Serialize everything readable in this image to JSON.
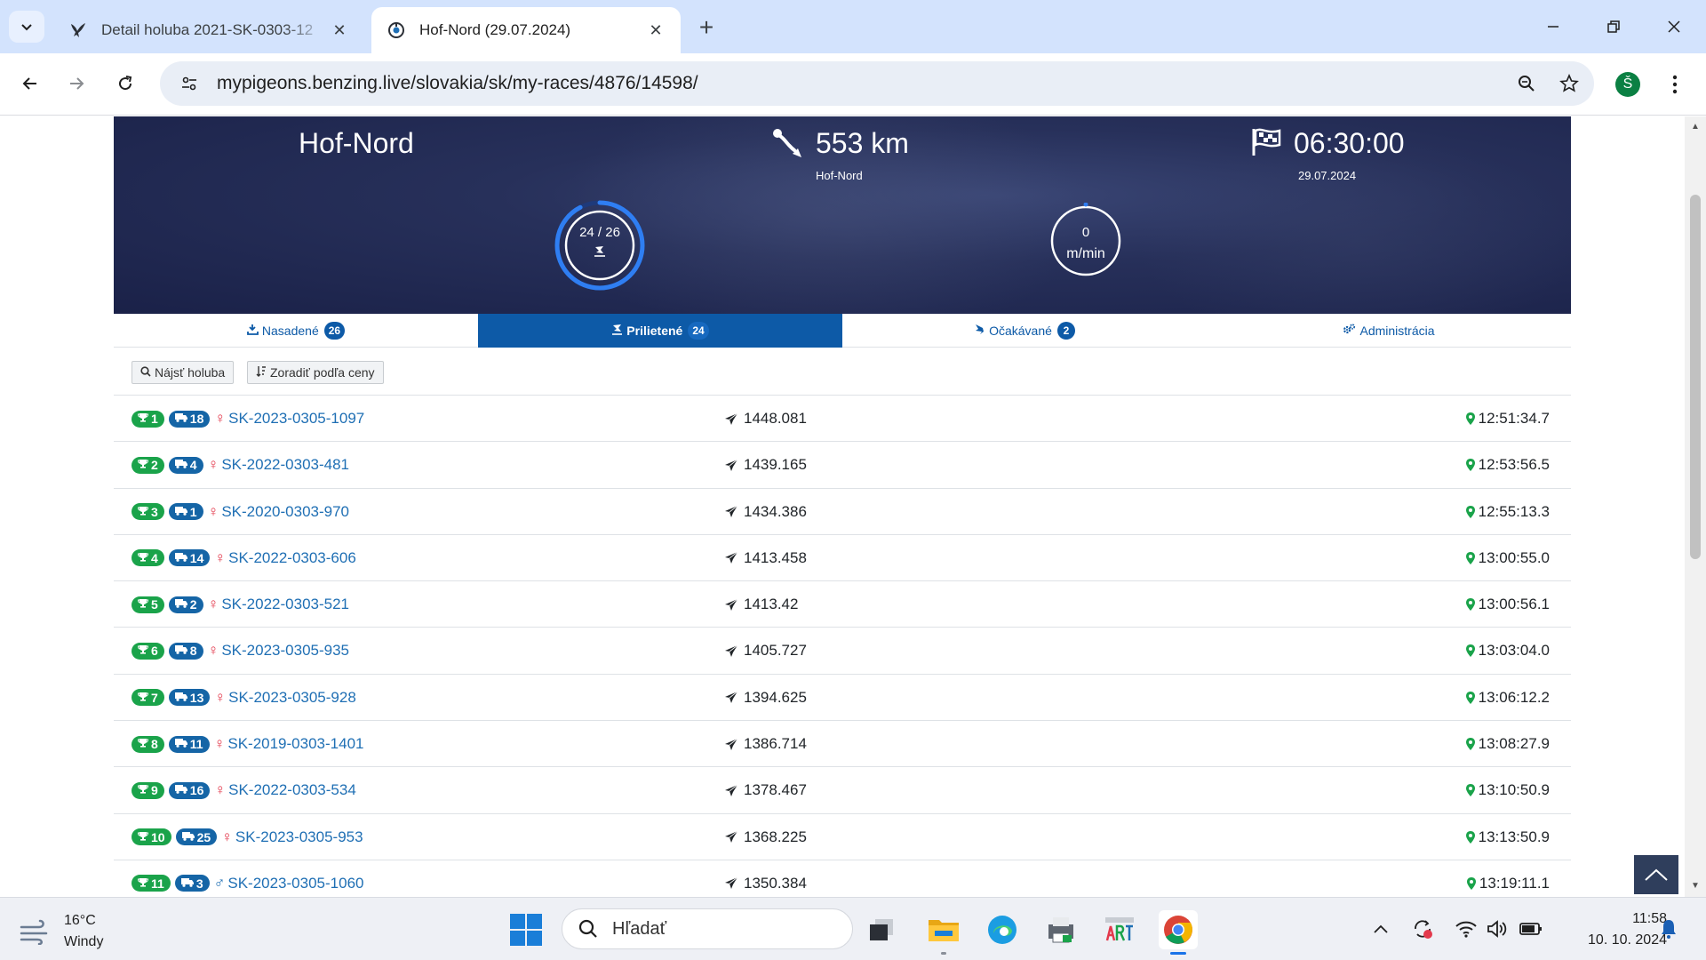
{
  "browser": {
    "tabs": [
      {
        "title": "Detail holuba 2021-SK-0303-12",
        "active": false
      },
      {
        "title": "Hof-Nord (29.07.2024)",
        "active": true
      }
    ],
    "url": "mypigeons.benzing.live/slovakia/sk/my-races/4876/14598/",
    "profile_initial": "Š"
  },
  "race": {
    "name": "Hof-Nord",
    "distance": "553 km",
    "release_point": "Hof-Nord",
    "start_time": "06:30:00",
    "date": "29.07.2024",
    "arrived_counter": "24 / 26",
    "arrived_fraction": 0.923,
    "speed_value": "0",
    "speed_unit": "m/min"
  },
  "page_tabs": [
    {
      "label": "Nasadené",
      "count": "26",
      "active": false
    },
    {
      "label": "Prilietené",
      "count": "24",
      "active": true
    },
    {
      "label": "Očakávané",
      "count": "2",
      "active": false
    },
    {
      "label": "Administrácia",
      "count": "",
      "active": false
    }
  ],
  "tools": {
    "find_label": "Nájsť holuba",
    "sort_label": "Zoradiť podľa ceny"
  },
  "results": [
    {
      "place": "1",
      "basket": "18",
      "sex": "female",
      "ring": "SK-2023-0305-1097",
      "speed": "1448.081",
      "arrival": "12:51:34.7"
    },
    {
      "place": "2",
      "basket": "4",
      "sex": "female",
      "ring": "SK-2022-0303-481",
      "speed": "1439.165",
      "arrival": "12:53:56.5"
    },
    {
      "place": "3",
      "basket": "1",
      "sex": "female",
      "ring": "SK-2020-0303-970",
      "speed": "1434.386",
      "arrival": "12:55:13.3"
    },
    {
      "place": "4",
      "basket": "14",
      "sex": "female",
      "ring": "SK-2022-0303-606",
      "speed": "1413.458",
      "arrival": "13:00:55.0"
    },
    {
      "place": "5",
      "basket": "2",
      "sex": "female",
      "ring": "SK-2022-0303-521",
      "speed": "1413.42",
      "arrival": "13:00:56.1"
    },
    {
      "place": "6",
      "basket": "8",
      "sex": "female",
      "ring": "SK-2023-0305-935",
      "speed": "1405.727",
      "arrival": "13:03:04.0"
    },
    {
      "place": "7",
      "basket": "13",
      "sex": "female",
      "ring": "SK-2023-0305-928",
      "speed": "1394.625",
      "arrival": "13:06:12.2"
    },
    {
      "place": "8",
      "basket": "11",
      "sex": "female",
      "ring": "SK-2019-0303-1401",
      "speed": "1386.714",
      "arrival": "13:08:27.9"
    },
    {
      "place": "9",
      "basket": "16",
      "sex": "female",
      "ring": "SK-2022-0303-534",
      "speed": "1378.467",
      "arrival": "13:10:50.9"
    },
    {
      "place": "10",
      "basket": "25",
      "sex": "female",
      "ring": "SK-2023-0305-953",
      "speed": "1368.225",
      "arrival": "13:13:50.9"
    },
    {
      "place": "11",
      "basket": "3",
      "sex": "male",
      "ring": "SK-2023-0305-1060",
      "speed": "1350.384",
      "arrival": "13:19:11.1"
    }
  ],
  "taskbar": {
    "weather_temp": "16°C",
    "weather_desc": "Windy",
    "search_placeholder": "Hľadať",
    "time": "11:58",
    "date": "10. 10. 2024"
  },
  "colors": {
    "primary": "#0d5aa7",
    "place_badge": "#1aa34a",
    "basket_badge": "#1565a6",
    "female": "#e3394c",
    "male": "#1f6fb4",
    "hero_bg": "#27305a"
  }
}
